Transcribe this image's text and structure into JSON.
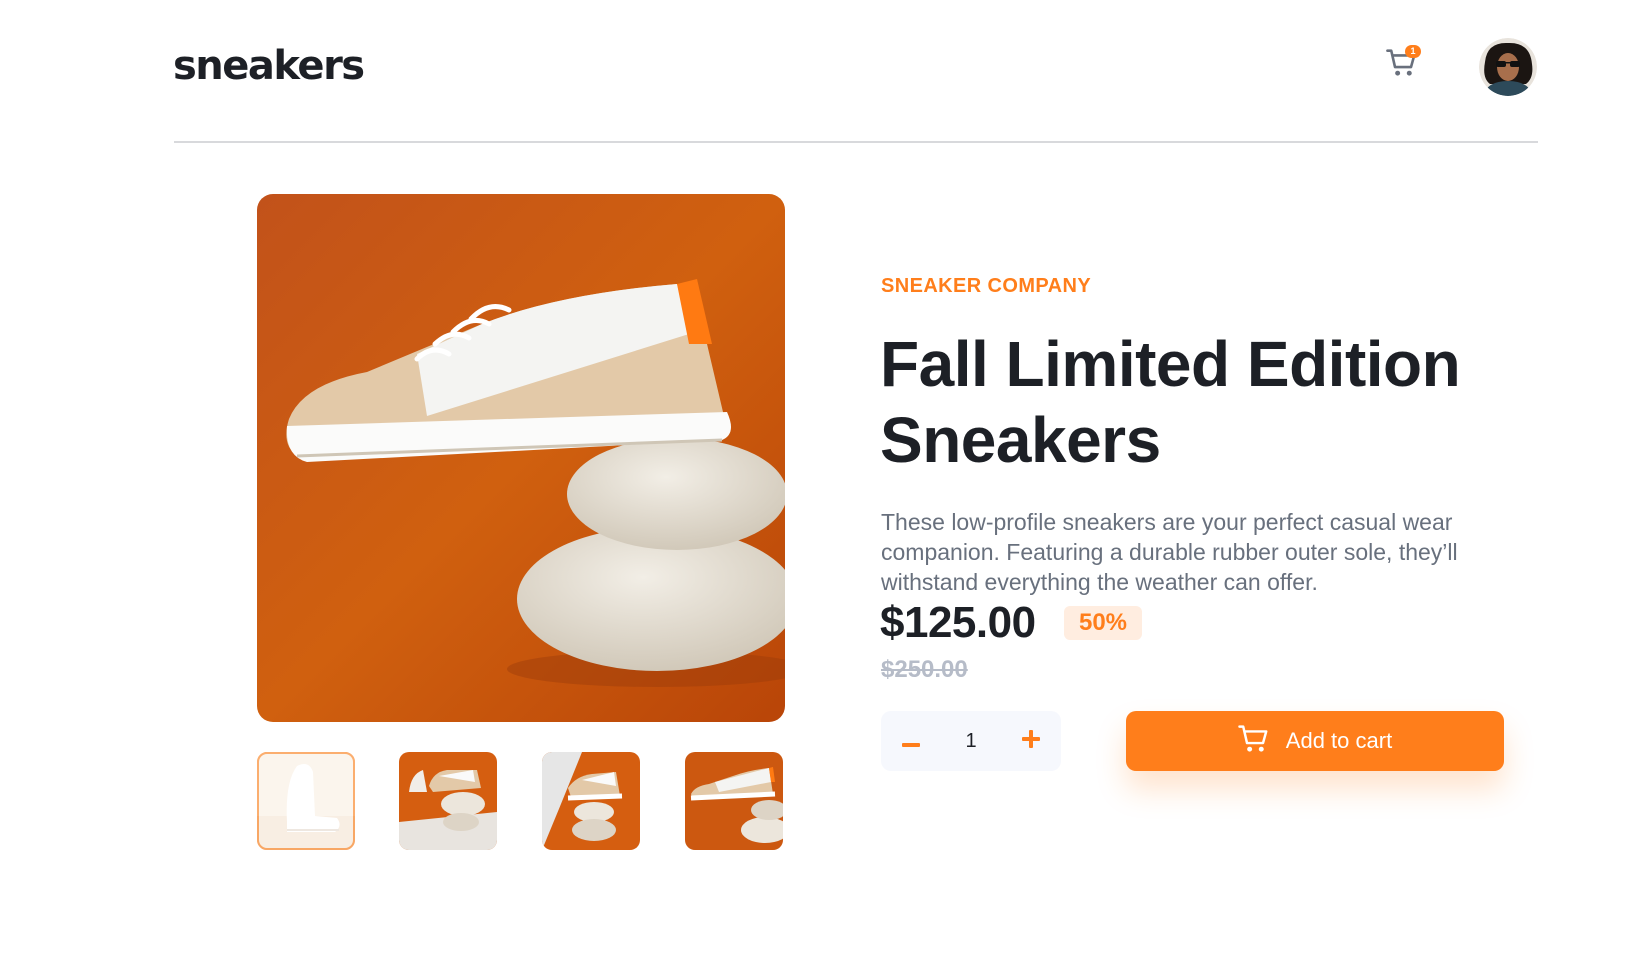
{
  "header": {
    "logo": "sneakers",
    "cart_count": "1"
  },
  "product": {
    "company": "SNEAKER COMPANY",
    "title": "Fall Limited Edition Sneakers",
    "description": "These low-profile sneakers are your perfect casual wear companion. Featuring a durable rubber outer sole, they’ll withstand everything the weather can offer.",
    "price": "$125.00",
    "discount": "50%",
    "original_price": "$250.00"
  },
  "quantity": {
    "value": "1"
  },
  "actions": {
    "add_to_cart_label": "Add to cart"
  },
  "gallery": {
    "selected_index": 0,
    "thumbnail_count": 4
  },
  "colors": {
    "accent": "#ff7e1b",
    "accent_pale": "#ffede0",
    "text_dark": "#1d2026",
    "text_muted": "#68707d",
    "text_light": "#b6bcc8"
  },
  "icons": [
    "cart-icon",
    "minus-icon",
    "plus-icon",
    "avatar"
  ]
}
